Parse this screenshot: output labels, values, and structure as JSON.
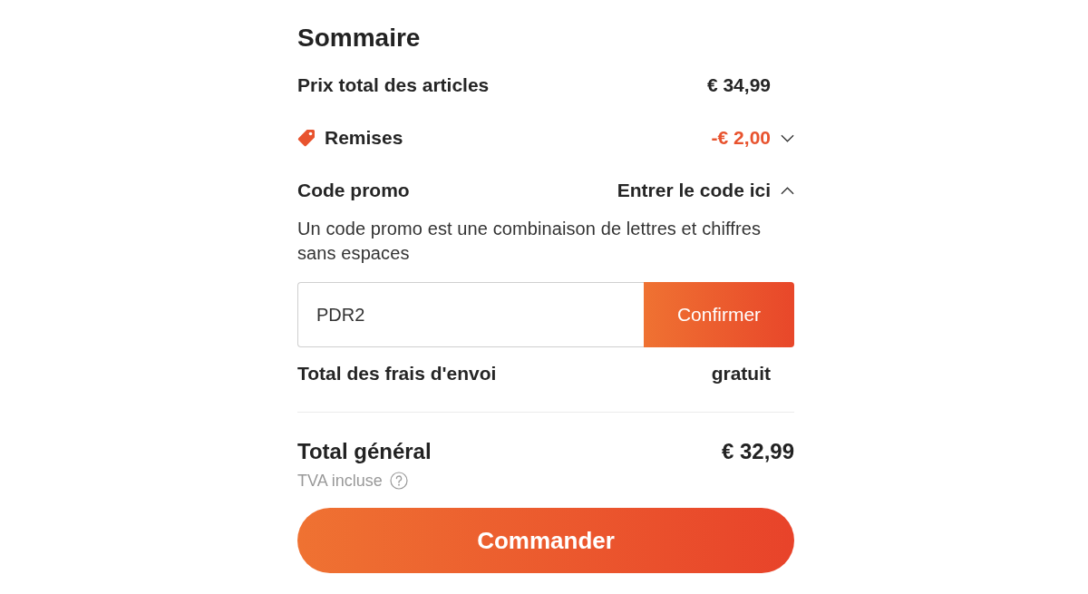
{
  "summary": {
    "title": "Sommaire",
    "rows": [
      {
        "kind": "line",
        "label": "Prix total des articles",
        "value": "€ 34,99"
      },
      {
        "kind": "discount",
        "label": "Remises",
        "value": "-€ 2,00",
        "expanded": false
      },
      {
        "kind": "promo",
        "label": "Code promo",
        "value": "Entrer le code ici",
        "expanded": true,
        "hint": "Un code promo est une combinaison de lettres et chiffres sans espaces",
        "input": {
          "value": "PDR2"
        },
        "button": "Confirmer"
      },
      {
        "kind": "line",
        "label": "Total des frais d'envoi",
        "value": "gratuit"
      }
    ],
    "total": {
      "label": "Total général",
      "value": "€ 32,99",
      "note": "TVA incluse"
    },
    "checkout_button": "Commander"
  }
}
